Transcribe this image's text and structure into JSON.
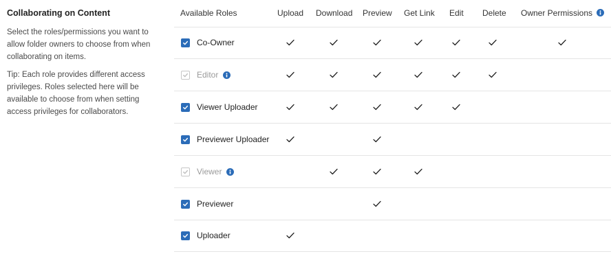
{
  "sidebar": {
    "title": "Collaborating on Content",
    "description": "Select the roles/permissions you want to allow folder owners to choose from when collaborating on items.",
    "tip": "Tip: Each role provides different access privileges. Roles selected here will be available to choose from when setting access privileges for collaborators."
  },
  "table": {
    "role_header": "Available Roles",
    "columns": [
      "Upload",
      "Download",
      "Preview",
      "Get Link",
      "Edit",
      "Delete",
      "Owner Permissions"
    ],
    "rows": [
      {
        "role": "Co-Owner",
        "checked": true,
        "disabled": false,
        "info": false,
        "perms": [
          true,
          true,
          true,
          true,
          true,
          true,
          true
        ]
      },
      {
        "role": "Editor",
        "checked": true,
        "disabled": true,
        "info": true,
        "perms": [
          true,
          true,
          true,
          true,
          true,
          true,
          false
        ]
      },
      {
        "role": "Viewer Uploader",
        "checked": true,
        "disabled": false,
        "info": false,
        "perms": [
          true,
          true,
          true,
          true,
          true,
          false,
          false
        ]
      },
      {
        "role": "Previewer Uploader",
        "checked": true,
        "disabled": false,
        "info": false,
        "perms": [
          true,
          false,
          true,
          false,
          false,
          false,
          false
        ]
      },
      {
        "role": "Viewer",
        "checked": true,
        "disabled": true,
        "info": true,
        "perms": [
          false,
          true,
          true,
          true,
          false,
          false,
          false
        ]
      },
      {
        "role": "Previewer",
        "checked": true,
        "disabled": false,
        "info": false,
        "perms": [
          false,
          false,
          true,
          false,
          false,
          false,
          false
        ]
      },
      {
        "role": "Uploader",
        "checked": true,
        "disabled": false,
        "info": false,
        "perms": [
          true,
          false,
          false,
          false,
          false,
          false,
          false
        ]
      }
    ]
  },
  "icons": {
    "checkbox": "checkbox-checked-icon",
    "info": "info-icon",
    "checkmark": "checkmark-icon"
  },
  "colors": {
    "accent": "#2b6cb8",
    "disabled_text": "#9a9a9a",
    "divider": "#e4e4e4"
  }
}
